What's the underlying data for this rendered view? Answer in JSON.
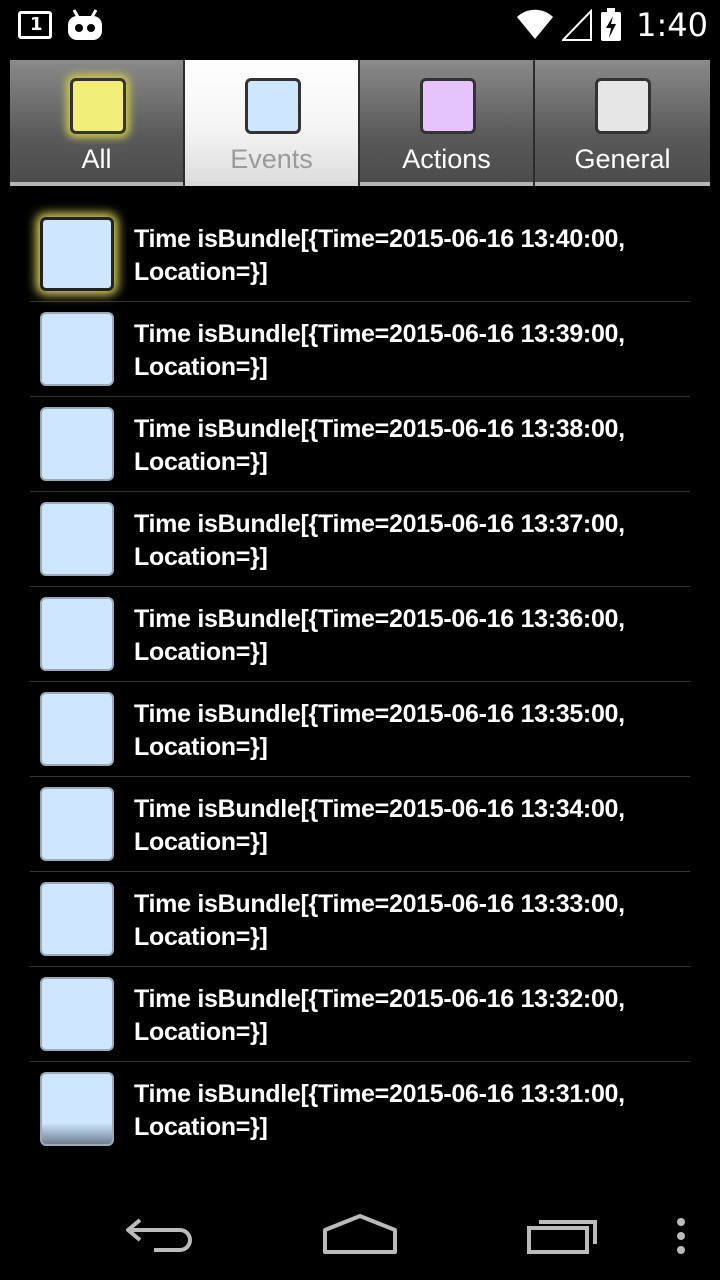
{
  "status_bar": {
    "notification_count": "1",
    "time": "1:40"
  },
  "tabs": [
    {
      "label": "All",
      "color": "#f2ee7a",
      "active": false
    },
    {
      "label": "Events",
      "color": "#cfe6ff",
      "active": true
    },
    {
      "label": "Actions",
      "color": "#e6c2ff",
      "active": false
    },
    {
      "label": "General",
      "color": "#e6e6e6",
      "active": false
    }
  ],
  "events": [
    {
      "text": "Time isBundle[{Time=2015-06-16 13:40:00, Location=}]"
    },
    {
      "text": "Time isBundle[{Time=2015-06-16 13:39:00, Location=}]"
    },
    {
      "text": "Time isBundle[{Time=2015-06-16 13:38:00, Location=}]"
    },
    {
      "text": "Time isBundle[{Time=2015-06-16 13:37:00, Location=}]"
    },
    {
      "text": "Time isBundle[{Time=2015-06-16 13:36:00, Location=}]"
    },
    {
      "text": "Time isBundle[{Time=2015-06-16 13:35:00, Location=}]"
    },
    {
      "text": "Time isBundle[{Time=2015-06-16 13:34:00, Location=}]"
    },
    {
      "text": "Time isBundle[{Time=2015-06-16 13:33:00, Location=}]"
    },
    {
      "text": "Time isBundle[{Time=2015-06-16 13:32:00, Location=}]"
    },
    {
      "text": "Time isBundle[{Time=2015-06-16 13:31:00, Location=}]"
    }
  ],
  "icons": {
    "status": [
      "notification-icon",
      "cyanogen-icon",
      "wifi-icon",
      "signal-icon",
      "battery-icon"
    ],
    "nav": [
      "back-icon",
      "home-icon",
      "recents-icon",
      "overflow-menu-icon"
    ]
  }
}
